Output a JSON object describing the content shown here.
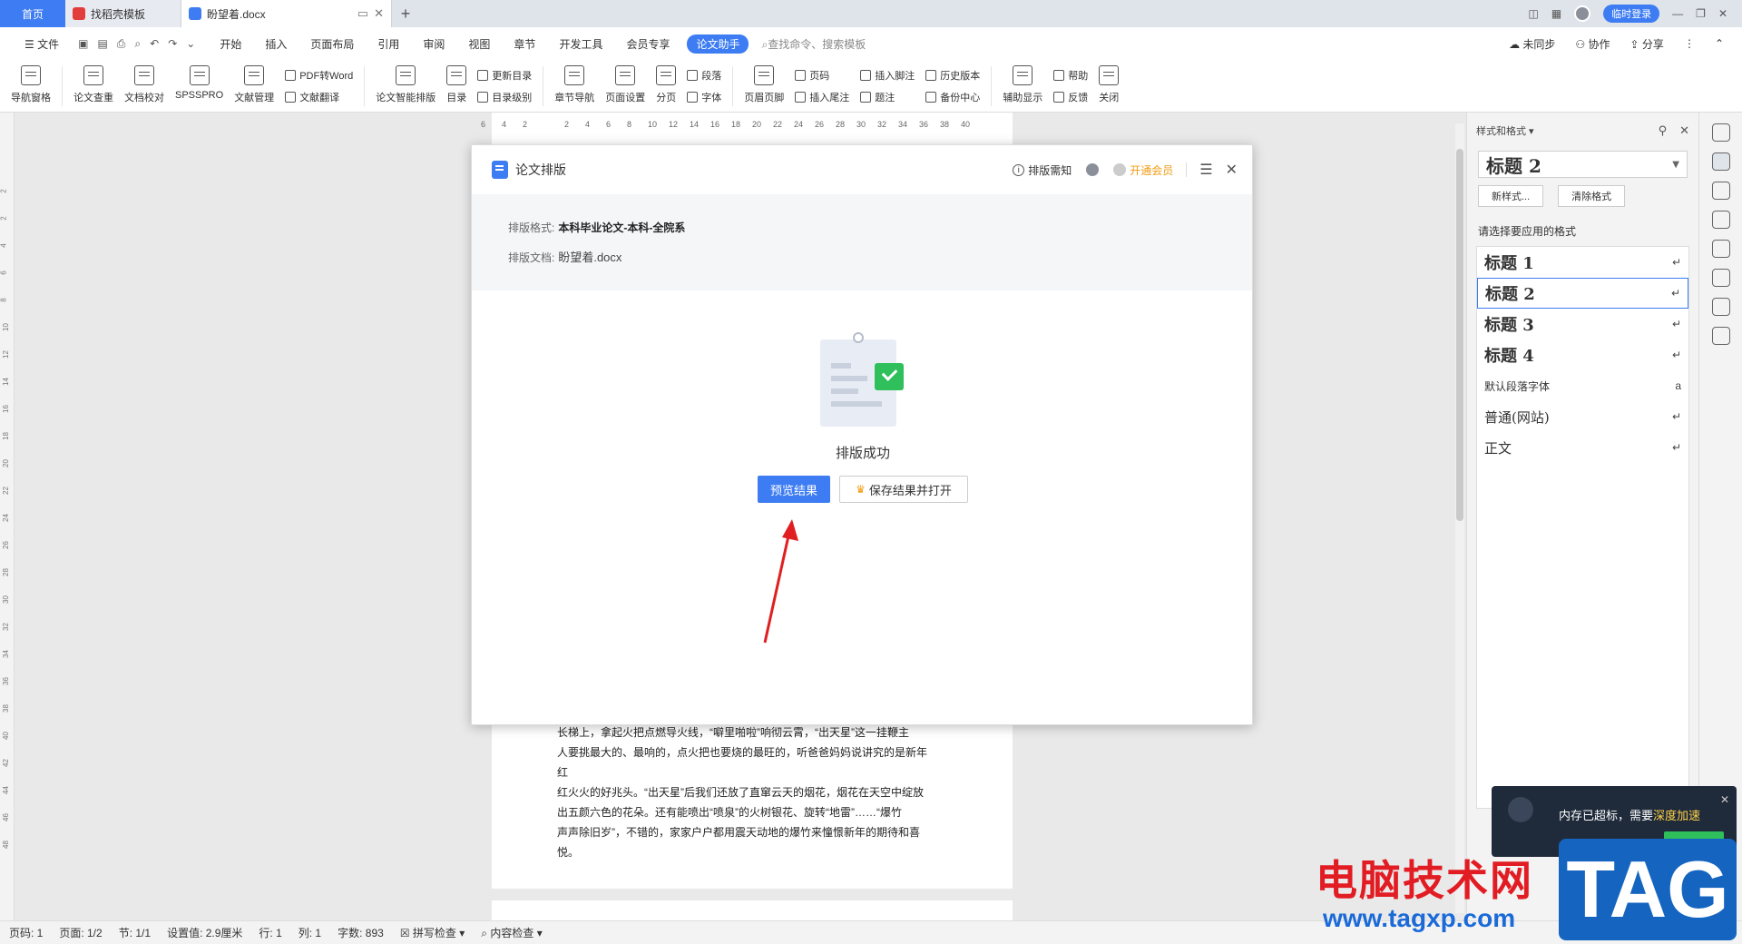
{
  "tabs": {
    "home": "首页",
    "items": [
      {
        "label": "找稻壳模板",
        "color": "#e23c3c"
      },
      {
        "label": "盼望着.docx",
        "color": "#3d7cf2"
      }
    ],
    "login": "临时登录"
  },
  "menu": {
    "file": "文件",
    "items": [
      "开始",
      "插入",
      "页面布局",
      "引用",
      "审阅",
      "视图",
      "章节",
      "开发工具",
      "会员专享"
    ],
    "active": "论文助手",
    "search": "查找命令、搜索模板",
    "right": [
      "未同步",
      "协作",
      "分享"
    ]
  },
  "ribbon": {
    "group1": [
      "导航窗格"
    ],
    "group2": [
      "论文查重",
      "文档校对",
      "SPSSPRO",
      "文献管理"
    ],
    "group2_small": [
      "PDF转Word",
      "文献翻译"
    ],
    "group3": [
      "论文智能排版",
      "目录"
    ],
    "group3_small": [
      "更新目录",
      "目录级别"
    ],
    "group4": [
      "章节导航",
      "页面设置",
      "分页"
    ],
    "group4_small": [
      "段落",
      "字体"
    ],
    "group5": [
      "页眉页脚"
    ],
    "group5_small": [
      "页码",
      "插入尾注",
      "插入脚注",
      "题注",
      "历史版本",
      "备份中心"
    ],
    "group6": [
      "辅助显示"
    ],
    "group6_small": [
      "帮助",
      "反馈"
    ],
    "group7": [
      "关闭"
    ]
  },
  "ruler": {
    "h": [
      "6",
      "4",
      "2",
      "",
      "2",
      "4",
      "6",
      "8",
      "10",
      "12",
      "14",
      "16",
      "18",
      "20",
      "22",
      "24",
      "26",
      "28",
      "30",
      "32",
      "34",
      "36",
      "38",
      "40"
    ],
    "v": [
      "2",
      "2",
      "4",
      "6",
      "8",
      "10",
      "12",
      "14",
      "16",
      "18",
      "20",
      "22",
      "24",
      "26",
      "28",
      "30",
      "32",
      "34",
      "36",
      "38",
      "40",
      "42",
      "44",
      "46",
      "48"
    ]
  },
  "document": {
    "lines": [
      "长梯上，拿起火把点燃导火线，“噼里啪啦”响彻云霄，“出天星”这一挂鞭主",
      "人要挑最大的、最响的，点火把也要烧的最旺的，听爸爸妈妈说讲究的是新年红",
      "红火火的好兆头。“出天星”后我们还放了直窜云天的烟花，烟花在天空中绽放",
      "出五颜六色的花朵。还有能喷出“喷泉”的火树银花、旋转“地雷”……“爆竹",
      "声声除旧岁”，不错的，家家户户都用震天动地的爆竹来憧憬新年的期待和喜悦。"
    ]
  },
  "right_panel": {
    "title": "样式和格式",
    "current": "标题 2",
    "new_style": "新样式...",
    "clear_format": "清除格式",
    "subtitle": "请选择要应用的格式",
    "styles": [
      {
        "name": "标题 1",
        "kind": "heading",
        "mark": "↵"
      },
      {
        "name": "标题 2",
        "kind": "heading",
        "mark": "↵",
        "selected": true
      },
      {
        "name": "标题 3",
        "kind": "heading",
        "mark": "↵"
      },
      {
        "name": "标题 4",
        "kind": "heading",
        "mark": "↵"
      },
      {
        "name": "默认段落字体",
        "kind": "small",
        "mark": "a"
      },
      {
        "name": "普通(网站)",
        "kind": "plain",
        "mark": "↵"
      },
      {
        "name": "正文",
        "kind": "plain",
        "mark": "↵"
      }
    ]
  },
  "dialog": {
    "title": "论文排版",
    "need": "排版需知",
    "vip": "开通会员",
    "format_label": "排版格式:",
    "format_value": "本科毕业论文-本科-全院系",
    "doc_label": "排版文档:",
    "doc_value": "盼望着.docx",
    "success": "排版成功",
    "preview": "预览结果",
    "save_open": "保存结果并打开"
  },
  "status": {
    "items": [
      "页码: 1",
      "页面: 1/2",
      "节: 1/1",
      "设置值: 2.9厘米",
      "行: 1",
      "列: 1",
      "字数: 893"
    ],
    "spell": "拼写检查",
    "content": "内容检查"
  },
  "toast": {
    "text": "内存已超标，需要",
    "highlight": "深度加速"
  },
  "watermark": {
    "title": "电脑技术网",
    "url": "www.tagxp.com",
    "tag": "TAG"
  },
  "colors": {
    "accent": "#3d7cf2",
    "success": "#2fbf5b",
    "vip": "#f39c12",
    "arrow": "#e02020"
  }
}
